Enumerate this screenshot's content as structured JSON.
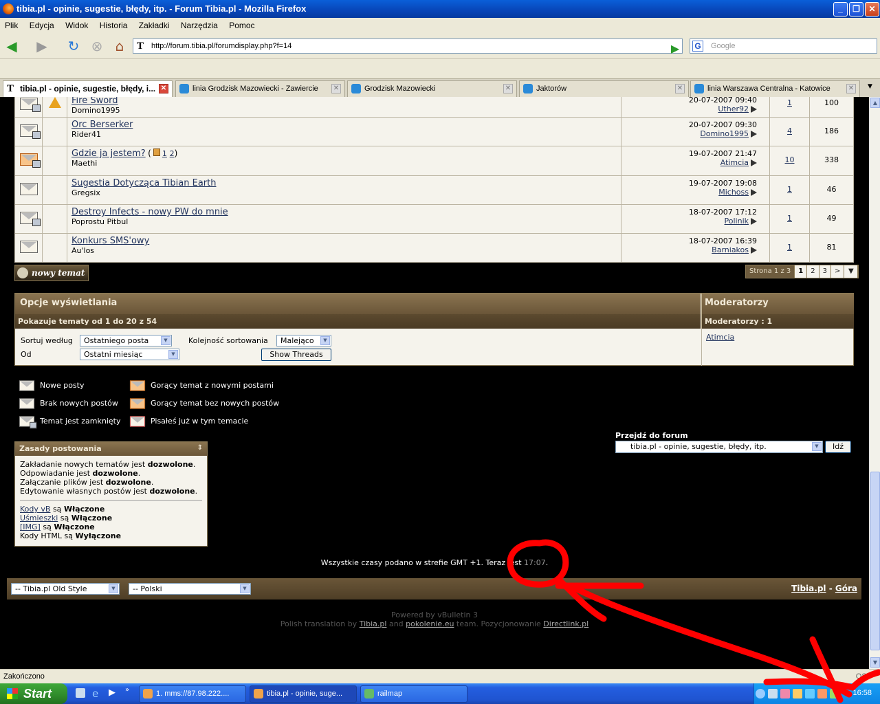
{
  "window": {
    "title": "tibia.pl - opinie, sugestie, błędy, itp. - Forum Tibia.pl - Mozilla Firefox"
  },
  "menu": [
    "Plik",
    "Edycja",
    "Widok",
    "Historia",
    "Zakładki",
    "Narzędzia",
    "Pomoc"
  ],
  "nav": {
    "url": "http://forum.tibia.pl/forumdisplay.php?f=14",
    "search_placeholder": "Google"
  },
  "tabs": [
    {
      "label": "tibia.pl - opinie, sugestie, błędy, i..."
    },
    {
      "label": "linia Grodzisk Mazowiecki - Zawiercie"
    },
    {
      "label": "Grodzisk Mazowiecki"
    },
    {
      "label": "Jaktorów"
    },
    {
      "label": "linia Warszawa Centralna - Katowice"
    }
  ],
  "threads": [
    {
      "title": "Fire Sword",
      "author": "Domino1995",
      "date": "20-07-2007",
      "time": "09:40",
      "last_poster": "Uther92",
      "replies": "1",
      "views": "100"
    },
    {
      "title": "Orc Berserker",
      "author": "Rider41",
      "date": "20-07-2007",
      "time": "09:30",
      "last_poster": "Domino1995",
      "replies": "4",
      "views": "186"
    },
    {
      "title": "Gdzie ja jestem?",
      "author": "Maethi",
      "date": "19-07-2007",
      "time": "21:47",
      "last_poster": "Atimcia",
      "replies": "10",
      "views": "338",
      "pages_prefix": "(",
      "page1": "1",
      "page2": "2",
      "pages_suffix": ")"
    },
    {
      "title": "Sugestia Dotycząca Tibian Earth",
      "author": "Gregsix",
      "date": "19-07-2007",
      "time": "19:08",
      "last_poster": "Michoss",
      "replies": "1",
      "views": "46"
    },
    {
      "title": "Destroy Infects - nowy PW do mnie",
      "author": "Poprostu Pitbul",
      "date": "18-07-2007",
      "time": "17:12",
      "last_poster": "Polinik",
      "replies": "1",
      "views": "49"
    },
    {
      "title": "Konkurs SMS'owy",
      "author": "Au'los",
      "date": "18-07-2007",
      "time": "16:39",
      "last_poster": "Barniakos",
      "replies": "1",
      "views": "81"
    }
  ],
  "new_topic_label": "nowy temat",
  "pager": {
    "label": "Strona 1 z 3",
    "current": "1",
    "p2": "2",
    "p3": "3",
    "next": ">",
    "menu": "▼"
  },
  "options": {
    "title": "Opcje wyświetlania",
    "showing": "Pokazuje tematy od 1 do 20 z 54",
    "sort_label": "Sortuj według",
    "sort_value": "Ostatniego posta",
    "order_label": "Kolejność sortowania",
    "order_value": "Malejąco",
    "from_label": "Od",
    "from_value": "Ostatni miesiąc",
    "show_button": "Show Threads",
    "mods_title": "Moderatorzy",
    "mods_count": "Moderatorzy : 1",
    "moderator": "Atimcia"
  },
  "legend": {
    "new_posts": "Nowe posty",
    "no_new_posts": "Brak nowych postów",
    "closed": "Temat jest zamknięty",
    "hot_new": "Gorący temat z nowymi postami",
    "hot_no_new": "Gorący temat bez nowych postów",
    "posted": "Pisałeś już w tym temacie"
  },
  "rules": {
    "title": "Zasady postowania",
    "l1a": "Zakładanie nowych tematów jest ",
    "l1b": "dozwolone",
    "l1c": ".",
    "l2a": "Odpowiadanie jest ",
    "l2b": "dozwolone",
    "l2c": ".",
    "l3a": "Załączanie plików jest ",
    "l3b": "dozwolone",
    "l3c": ".",
    "l4a": "Edytowanie własnych postów jest ",
    "l4b": "dozwolone",
    "l4c": ".",
    "vb": "Kody vB",
    "vb_state": "Włączone",
    "smilies": "Uśmieszki",
    "smilies_state": "Włączone",
    "img": "[IMG]",
    "img_state": "Włączone",
    "html": "Kody HTML",
    "html_state": "Wyłączone",
    "are": "są"
  },
  "jump": {
    "label": "Przejdź do forum",
    "value": "tibia.pl - opinie, sugestie, błędy, itp.",
    "button": "Idź"
  },
  "time_note": {
    "text": "Wszystkie czasy podano w strefie GMT +1. Teraz jest ",
    "now": "17:07",
    "end": "."
  },
  "footer": {
    "style": "-- Tibia.pl Old Style",
    "lang": "-- Polski",
    "link1": "Tibia.pl",
    "sep": " - ",
    "link2": "Góra",
    "powered": "Powered by vBulletin 3",
    "translation_pre": "Polish translation by ",
    "translation_l1": "Tibia.pl",
    "translation_and": " and ",
    "translation_l2": "pokolenie.eu",
    "translation_post": " team. Pozycjonowanie ",
    "translation_l3": "Directlink.pl"
  },
  "status": "Zakończono",
  "status_right": "OSS",
  "taskbar": {
    "start": "Start",
    "items": [
      "1. mms://87.98.222....",
      "tibia.pl - opinie, suge...",
      "railmap"
    ],
    "clock": "16:58"
  },
  "colors": {
    "accent": "#6a5638",
    "annotation": "#ff0000"
  }
}
